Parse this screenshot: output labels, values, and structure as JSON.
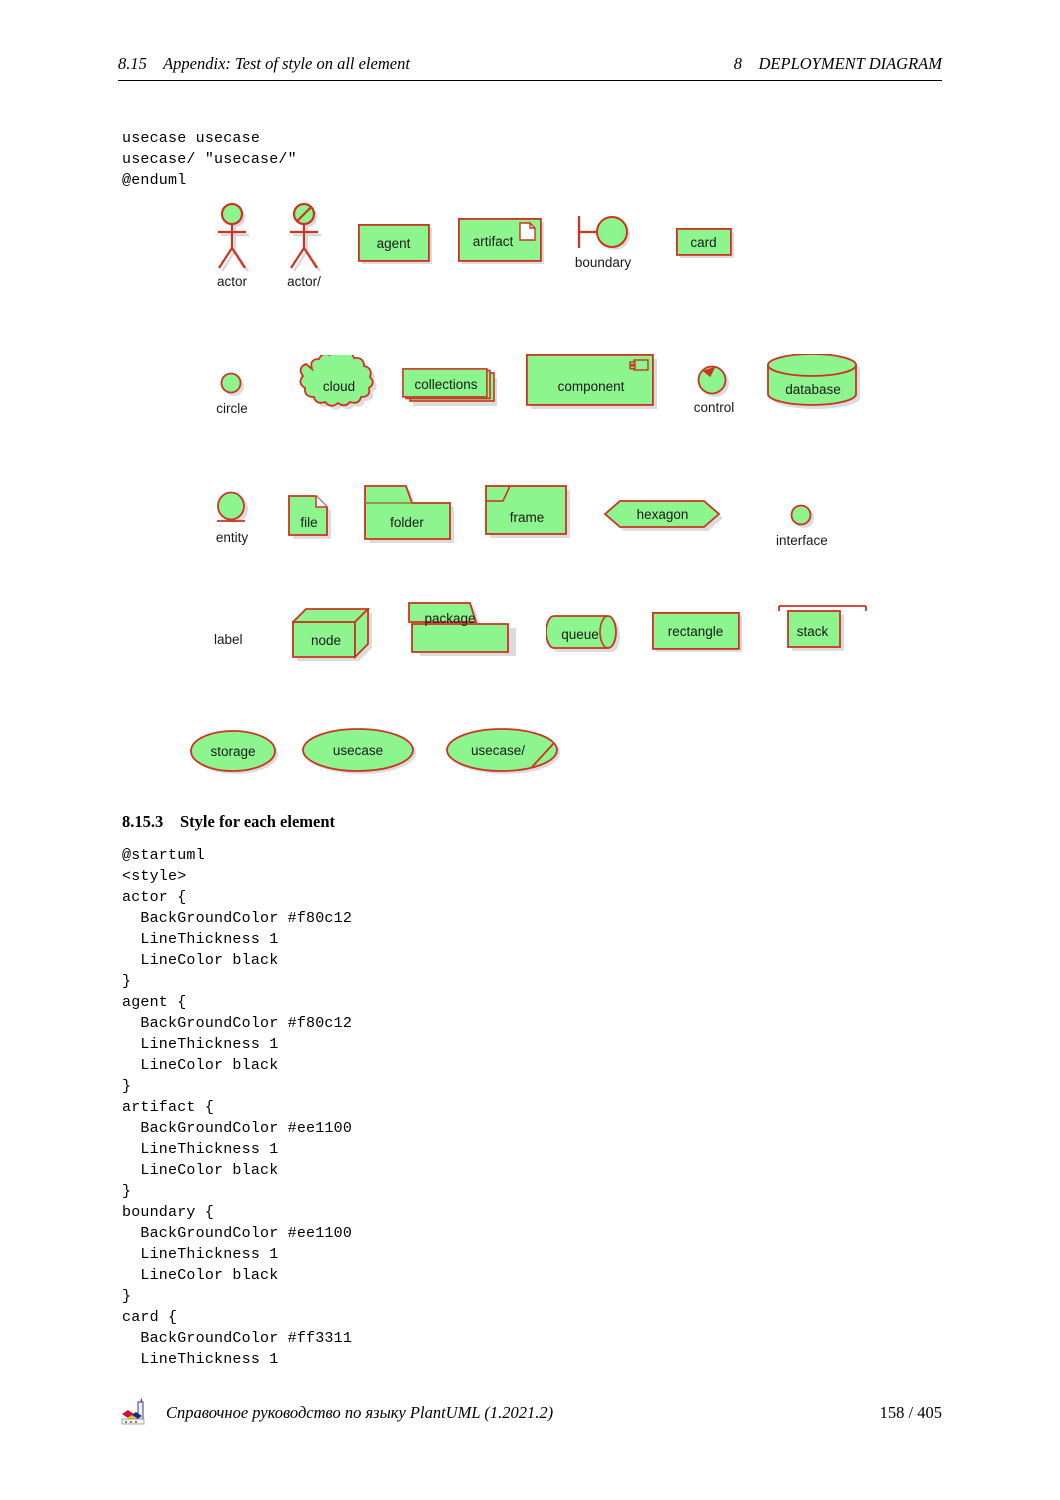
{
  "header": {
    "left": "8.15    Appendix: Test of style on all element",
    "right": "8    DEPLOYMENT DIAGRAM"
  },
  "code_top": "usecase usecase\nusecase/ \"usecase/\"\n@enduml",
  "section": {
    "number": "8.15.3",
    "title": "Style for each element"
  },
  "code_bottom": "@startuml\n<style>\nactor {\n  BackGroundColor #f80c12\n  LineThickness 1\n  LineColor black\n}\nagent {\n  BackGroundColor #f80c12\n  LineThickness 1\n  LineColor black\n}\nartifact {\n  BackGroundColor #ee1100\n  LineThickness 1\n  LineColor black\n}\nboundary {\n  BackGroundColor #ee1100\n  LineThickness 1\n  LineColor black\n}\ncard {\n  BackGroundColor #ff3311\n  LineThickness 1",
  "colors": {
    "shape_fill": "#8df58d",
    "shape_stroke": "#cc3322",
    "shadow": "#b9b9b9",
    "text": "#1a1a1a"
  },
  "diagram": {
    "rows": [
      {
        "items": [
          {
            "name": "actor",
            "shape": "actor",
            "caption": "actor",
            "text": ""
          },
          {
            "name": "actor-slash",
            "shape": "actor-slash",
            "caption": "actor/",
            "text": ""
          },
          {
            "name": "agent",
            "shape": "rect",
            "caption": "",
            "text": "agent"
          },
          {
            "name": "artifact",
            "shape": "artifact",
            "caption": "",
            "text": "artifact"
          },
          {
            "name": "boundary",
            "shape": "boundary",
            "caption": "boundary",
            "text": ""
          },
          {
            "name": "card",
            "shape": "rect",
            "caption": "",
            "text": "card"
          }
        ]
      },
      {
        "items": [
          {
            "name": "circle",
            "shape": "small-circle",
            "caption": "circle",
            "text": ""
          },
          {
            "name": "cloud",
            "shape": "cloud",
            "caption": "",
            "text": "cloud"
          },
          {
            "name": "collections",
            "shape": "collections",
            "caption": "",
            "text": "collections"
          },
          {
            "name": "component",
            "shape": "component",
            "caption": "",
            "text": "component"
          },
          {
            "name": "control",
            "shape": "control",
            "caption": "control",
            "text": ""
          },
          {
            "name": "database",
            "shape": "database",
            "caption": "",
            "text": "database"
          }
        ]
      },
      {
        "items": [
          {
            "name": "entity",
            "shape": "entity",
            "caption": "entity",
            "text": ""
          },
          {
            "name": "file",
            "shape": "file",
            "caption": "",
            "text": "file"
          },
          {
            "name": "folder",
            "shape": "folder",
            "caption": "",
            "text": "folder"
          },
          {
            "name": "frame",
            "shape": "frame",
            "caption": "",
            "text": "frame"
          },
          {
            "name": "hexagon",
            "shape": "hexagon",
            "caption": "",
            "text": "hexagon"
          },
          {
            "name": "interface",
            "shape": "small-circle",
            "caption": "interface",
            "text": ""
          }
        ]
      },
      {
        "items": [
          {
            "name": "label",
            "shape": "none",
            "caption": "label",
            "text": ""
          },
          {
            "name": "node",
            "shape": "node",
            "caption": "",
            "text": "node"
          },
          {
            "name": "package",
            "shape": "package",
            "caption": "",
            "text": "package"
          },
          {
            "name": "queue",
            "shape": "queue",
            "caption": "",
            "text": "queue"
          },
          {
            "name": "rectangle",
            "shape": "rect",
            "caption": "",
            "text": "rectangle"
          },
          {
            "name": "stack",
            "shape": "stack",
            "caption": "",
            "text": "stack"
          }
        ]
      },
      {
        "items": [
          {
            "name": "storage",
            "shape": "ellipse",
            "caption": "",
            "text": "storage"
          },
          {
            "name": "usecase",
            "shape": "ellipse",
            "caption": "",
            "text": "usecase"
          },
          {
            "name": "usecase-slash",
            "shape": "ellipse-slash",
            "caption": "",
            "text": "usecase/"
          }
        ]
      }
    ]
  },
  "footer": {
    "title": "Справочное руководство по языку PlantUML (1.2021.2)",
    "page": "158 / 405"
  }
}
